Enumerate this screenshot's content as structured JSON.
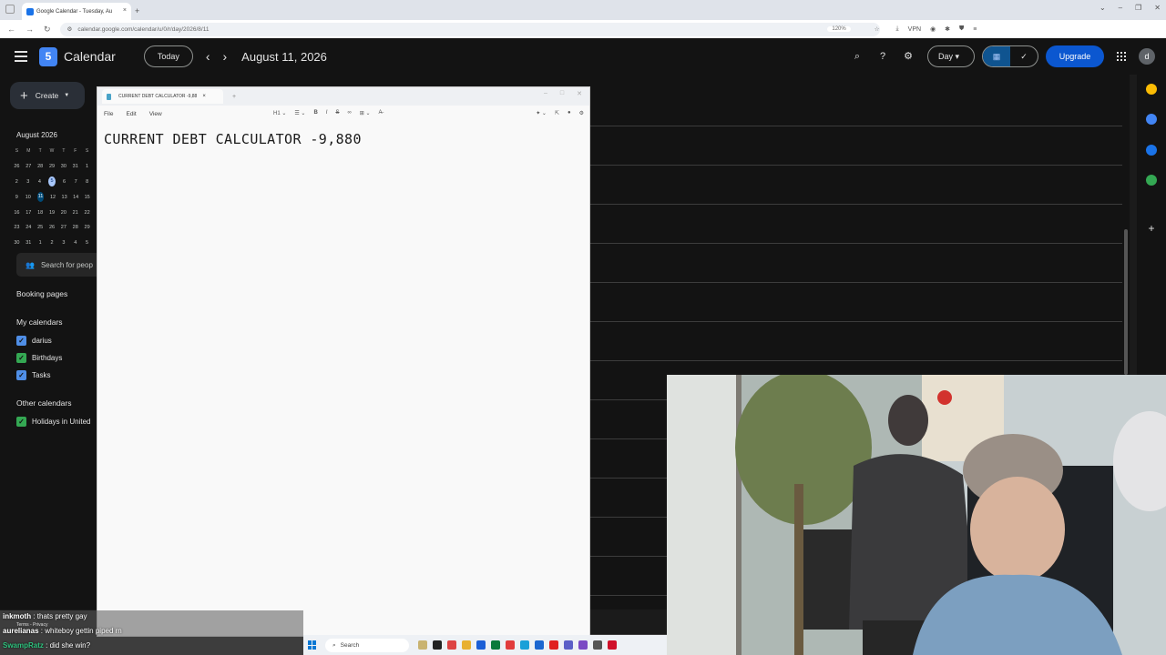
{
  "browser": {
    "tab_title": "Google Calendar - Tuesday, Au",
    "url": "calendar.google.com/calendar/u/0/r/day/2026/8/11",
    "zoom": "120%",
    "vpn_label": "VPN"
  },
  "header": {
    "app_title": "Calendar",
    "logo_number": "5",
    "today_label": "Today",
    "prev_icon": "chevron-left-icon",
    "next_icon": "chevron-right-icon",
    "date_title": "August 11, 2026",
    "view_label": "Day",
    "upgrade_label": "Upgrade",
    "avatar_letter": "d"
  },
  "sidebar": {
    "create_label": "Create",
    "mini_month": "August 2026",
    "weekdays": [
      "S",
      "M",
      "T",
      "W",
      "T",
      "F",
      "S"
    ],
    "weeks": [
      [
        "26",
        "27",
        "28",
        "29",
        "30",
        "31",
        "1"
      ],
      [
        "2",
        "3",
        "4",
        "5",
        "6",
        "7",
        "8"
      ],
      [
        "9",
        "10",
        "11",
        "12",
        "13",
        "14",
        "15"
      ],
      [
        "16",
        "17",
        "18",
        "19",
        "20",
        "21",
        "22"
      ],
      [
        "23",
        "24",
        "25",
        "26",
        "27",
        "28",
        "29"
      ],
      [
        "30",
        "31",
        "1",
        "2",
        "3",
        "4",
        "5"
      ]
    ],
    "search_people": "Search for peop",
    "booking_pages": "Booking pages",
    "my_calendars_title": "My calendars",
    "my_calendars": [
      {
        "label": "darius",
        "color": "#4f8ee6"
      },
      {
        "label": "Birthdays",
        "color": "#34a853"
      },
      {
        "label": "Tasks",
        "color": "#4f8ee6"
      }
    ],
    "other_calendars_title": "Other calendars",
    "other_calendars": [
      {
        "label": "Holidays in United",
        "color": "#34a853"
      }
    ]
  },
  "editor": {
    "tab_title": "CURRENT DEBT CALCULATOR -9,88",
    "menu": [
      "File",
      "Edit",
      "View"
    ],
    "heading_style": "H1",
    "document_text": "CURRENT DEBT CALCULATOR -9,880"
  },
  "taskbar": {
    "search_label": "Search"
  },
  "chat": {
    "messages": [
      {
        "user": "inkmoth",
        "text": " : thats pretty gay",
        "color": "#ffffff"
      },
      {
        "user": "aurelianas",
        "text": " : whiteboy gettin piped rn",
        "color": "#ffffff"
      },
      {
        "user": "SwampRatz",
        "text": " : did she win?",
        "color": "#2ec27e"
      }
    ],
    "footer": "Terms - Privacy"
  },
  "colors": {
    "accent": "#0b57d0",
    "selected_day": "#004a77",
    "today_highlight": "#a8c7fa"
  }
}
